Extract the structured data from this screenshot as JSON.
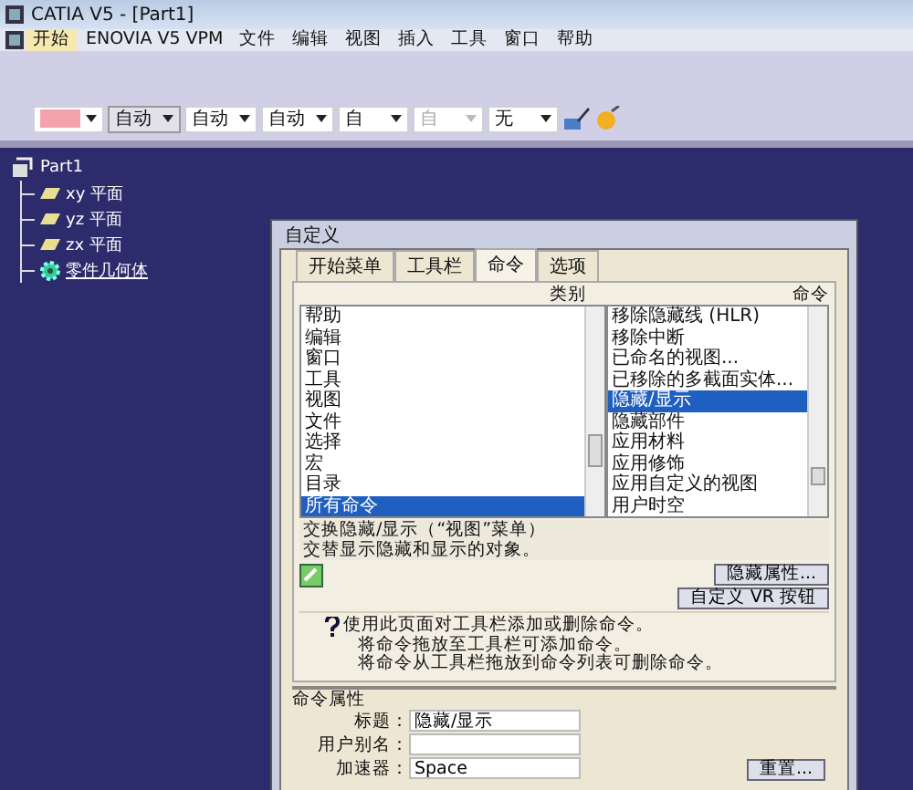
{
  "window": {
    "title": "CATIA V5 - [Part1]"
  },
  "menu": [
    {
      "label": "开始",
      "selected": true
    },
    {
      "label": "ENOVIA V5 VPM",
      "selected": false
    },
    {
      "label": "文件",
      "selected": false
    },
    {
      "label": "编辑",
      "selected": false
    },
    {
      "label": "视图",
      "selected": false
    },
    {
      "label": "插入",
      "selected": false
    },
    {
      "label": "工具",
      "selected": false
    },
    {
      "label": "窗口",
      "selected": false
    },
    {
      "label": "帮助",
      "selected": false
    }
  ],
  "toolbar": [
    {
      "kind": "color",
      "color": "#f4a3ad"
    },
    {
      "kind": "combo",
      "value": "自动",
      "selected": true,
      "disabled": false
    },
    {
      "kind": "combo",
      "value": "自动",
      "selected": false,
      "disabled": false
    },
    {
      "kind": "combo",
      "value": "自动",
      "selected": false,
      "disabled": false
    },
    {
      "kind": "combo",
      "value": "自",
      "selected": false,
      "disabled": false
    },
    {
      "kind": "combo",
      "value": "自",
      "selected": false,
      "disabled": true
    },
    {
      "kind": "combo",
      "value": "无",
      "selected": false,
      "disabled": false
    }
  ],
  "tree": {
    "root": "Part1",
    "children": [
      {
        "label": "xy 平面",
        "kind": "plane"
      },
      {
        "label": "yz 平面",
        "kind": "plane"
      },
      {
        "label": "zx 平面",
        "kind": "plane"
      },
      {
        "label": "零件几何体",
        "kind": "body"
      }
    ]
  },
  "dialog": {
    "title": "自定义",
    "tabs": [
      {
        "label": "开始菜单",
        "selected": false
      },
      {
        "label": "工具栏",
        "selected": false
      },
      {
        "label": "命令",
        "selected": true
      },
      {
        "label": "选项",
        "selected": false
      }
    ],
    "category_header": "类别",
    "command_header": "命令",
    "categories": [
      {
        "label": "帮助",
        "selected": false
      },
      {
        "label": "编辑",
        "selected": false
      },
      {
        "label": "窗口",
        "selected": false
      },
      {
        "label": "工具",
        "selected": false
      },
      {
        "label": "视图",
        "selected": false
      },
      {
        "label": "文件",
        "selected": false
      },
      {
        "label": "选择",
        "selected": false
      },
      {
        "label": "宏",
        "selected": false
      },
      {
        "label": "目录",
        "selected": false
      },
      {
        "label": "所有命令",
        "selected": true
      }
    ],
    "commands": [
      {
        "label": "移除隐藏线 (HLR)",
        "selected": false
      },
      {
        "label": "移除中断",
        "selected": false
      },
      {
        "label": "已命名的视图...",
        "selected": false
      },
      {
        "label": "已移除的多截面实体...",
        "selected": false
      },
      {
        "label": "隐藏/显示",
        "selected": true
      },
      {
        "label": "隐藏部件",
        "selected": false
      },
      {
        "label": "应用材料",
        "selected": false
      },
      {
        "label": "应用修饰",
        "selected": false
      },
      {
        "label": "应用自定义的视图",
        "selected": false
      },
      {
        "label": "用户时空",
        "selected": false
      }
    ],
    "description": [
      "交换隐藏/显示（“视图”菜单）",
      "交替显示隐藏和显示的对象。"
    ],
    "buttons": [
      "隐藏属性...",
      "自定义 VR 按钮"
    ],
    "help": [
      "使用此页面对工具栏添加或删除命令。",
      "将命令拖放至工具栏可添加命令。",
      "将命令从工具栏拖放到命令列表可删除命令。"
    ],
    "properties": {
      "title": "命令属性",
      "fields": [
        {
          "label": "标题：",
          "value": "隐藏/显示"
        },
        {
          "label": "用户别名："
        },
        {
          "label": "加速器：",
          "value": "Space"
        }
      ],
      "reset": "重置..."
    }
  }
}
